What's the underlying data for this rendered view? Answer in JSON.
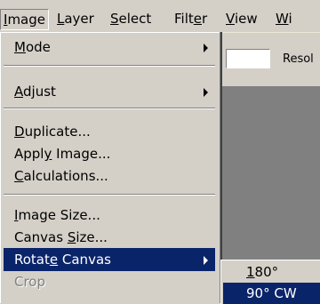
{
  "menubar": {
    "items": [
      {
        "pre": "",
        "acc": "I",
        "post": "mage"
      },
      {
        "pre": "",
        "acc": "L",
        "post": "ayer"
      },
      {
        "pre": "",
        "acc": "S",
        "post": "elect"
      },
      {
        "pre": "Filt",
        "acc": "e",
        "post": "r"
      },
      {
        "pre": "",
        "acc": "V",
        "post": "iew"
      },
      {
        "pre": "",
        "acc": "W",
        "post": "i"
      }
    ]
  },
  "options": {
    "resolution_label": "Resol"
  },
  "image_menu": {
    "items": [
      {
        "pre": "",
        "acc": "M",
        "post": "ode"
      },
      {
        "pre": "",
        "acc": "A",
        "post": "djust"
      },
      {
        "pre": "",
        "acc": "D",
        "post": "uplicate..."
      },
      {
        "pre": "Appl",
        "acc": "y",
        "post": " Image..."
      },
      {
        "pre": "",
        "acc": "C",
        "post": "alculations..."
      },
      {
        "pre": "",
        "acc": "I",
        "post": "mage Size..."
      },
      {
        "pre": "Canvas ",
        "acc": "S",
        "post": "ize..."
      },
      {
        "pre": "Rotat",
        "acc": "e",
        "post": " Canvas"
      },
      {
        "pre": "Crop",
        "acc": "",
        "post": ""
      }
    ]
  },
  "rotate_submenu": {
    "items": [
      {
        "pre": "",
        "acc": "1",
        "post": "80°"
      },
      {
        "pre": "90° CW",
        "acc": "",
        "post": ""
      }
    ]
  }
}
